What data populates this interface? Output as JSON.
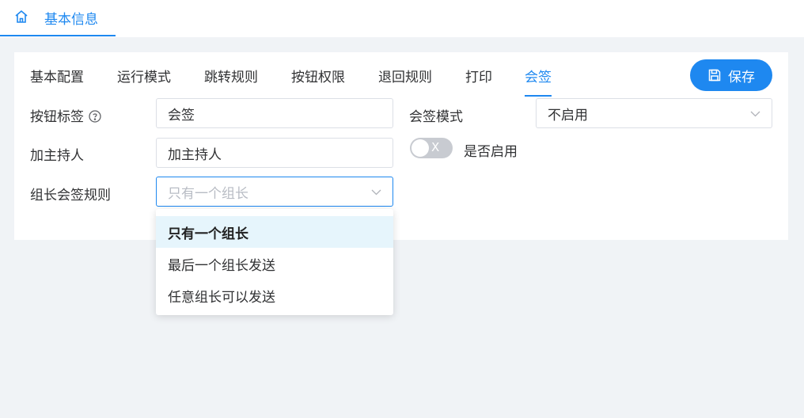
{
  "header": {
    "home_tab_label": "基本信息",
    "home_icon": "home-icon"
  },
  "tabs": [
    {
      "label": "基本配置",
      "active": false
    },
    {
      "label": "运行模式",
      "active": false
    },
    {
      "label": "跳转规则",
      "active": false
    },
    {
      "label": "按钮权限",
      "active": false
    },
    {
      "label": "退回规则",
      "active": false
    },
    {
      "label": "打印",
      "active": false
    },
    {
      "label": "会签",
      "active": true
    }
  ],
  "toolbar": {
    "save_label": "保存",
    "save_icon": "save-icon"
  },
  "form": {
    "button_label": {
      "label": "按钮标签",
      "value": "会签",
      "help_icon": "question-circle-icon"
    },
    "countersign_mode": {
      "label": "会签模式",
      "value": "不启用"
    },
    "add_host": {
      "label": "加主持人",
      "value": "加主持人"
    },
    "enable_toggle": {
      "label": "是否启用",
      "on": false,
      "off_glyph": "X"
    },
    "leader_rule": {
      "label": "组长会签规则",
      "placeholder": "只有一个组长"
    }
  },
  "dropdown": {
    "options": [
      "只有一个组长",
      "最后一个组长发送",
      "任意组长可以发送"
    ],
    "selected_index": 0
  },
  "colors": {
    "accent": "#1e88f0",
    "page_bg": "#f0f3f6",
    "option_hover": "#e6f5fc"
  }
}
